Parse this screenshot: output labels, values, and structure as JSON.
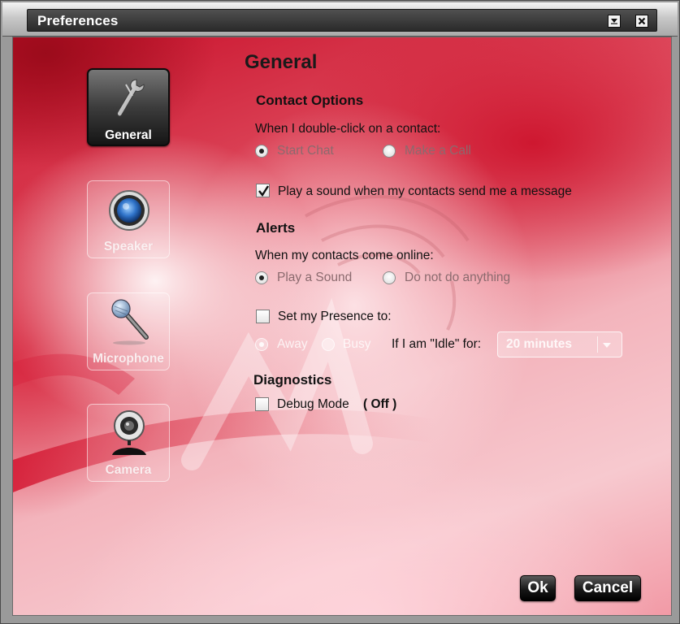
{
  "window": {
    "title": "Preferences"
  },
  "sidebar": {
    "items": [
      {
        "label": "General",
        "icon": "wrench-icon",
        "active": true
      },
      {
        "label": "Speaker",
        "icon": "speaker-icon",
        "active": false
      },
      {
        "label": "Microphone",
        "icon": "microphone-icon",
        "active": false
      },
      {
        "label": "Camera",
        "icon": "webcam-icon",
        "active": false
      }
    ]
  },
  "main": {
    "page_title": "General",
    "contact_options": {
      "heading": "Contact Options",
      "double_click_label": "When I double-click on a contact:",
      "options": [
        {
          "label": "Start Chat",
          "checked": true
        },
        {
          "label": "Make a Call",
          "checked": false
        }
      ],
      "play_sound_label": "Play a sound when my contacts send me a message",
      "play_sound_checked": true
    },
    "alerts": {
      "heading": "Alerts",
      "online_label": "When my contacts come online:",
      "options": [
        {
          "label": "Play a Sound",
          "checked": true
        },
        {
          "label": "Do not do anything",
          "checked": false
        }
      ],
      "presence_label": "Set my Presence to:",
      "presence_checked": false,
      "presence_options": [
        {
          "label": "Away",
          "checked": true
        },
        {
          "label": "Busy",
          "checked": false
        }
      ],
      "idle_label": "If I am \"Idle\" for:",
      "idle_value": "20 minutes"
    },
    "diagnostics": {
      "heading": "Diagnostics",
      "debug_label": "Debug Mode",
      "debug_state": "( Off )",
      "debug_checked": false
    }
  },
  "footer": {
    "ok_label": "Ok",
    "cancel_label": "Cancel"
  },
  "colors": {
    "accent_red": "#c8102a",
    "button_black": "#181818"
  }
}
